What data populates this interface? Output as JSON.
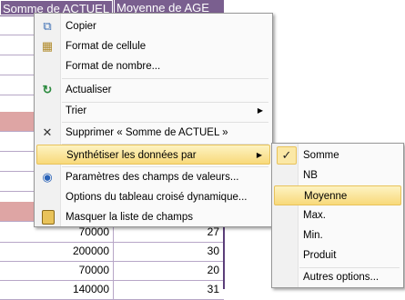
{
  "sheet": {
    "header_col1": "Somme de ACTUEL",
    "header_col2": "Moyenne de AGE",
    "rows_visible": [
      {
        "c1": "70000",
        "c2": "27"
      },
      {
        "c1": "200000",
        "c2": "30"
      },
      {
        "c1": "70000",
        "c2": "20"
      },
      {
        "c1": "140000",
        "c2": "31"
      }
    ]
  },
  "context_menu": {
    "items": [
      {
        "label": "Copier",
        "icon": "copy-icon"
      },
      {
        "label": "Format de cellule",
        "icon": "format-cell-icon"
      },
      {
        "label": "Format de nombre...",
        "icon": ""
      },
      {
        "label": "Actualiser",
        "icon": "refresh-icon"
      },
      {
        "label": "Trier",
        "icon": "",
        "arrow": "▶"
      },
      {
        "label": "Supprimer « Somme de ACTUEL »",
        "icon": "delete-icon"
      },
      {
        "label": "Synthétiser les données par",
        "icon": "",
        "arrow": "▶"
      },
      {
        "label": "Paramètres des champs de valeurs...",
        "icon": "field-settings-icon"
      },
      {
        "label": "Options du tableau croisé dynamique...",
        "icon": ""
      },
      {
        "label": "Masquer la liste de champs",
        "icon": "field-list-icon"
      }
    ]
  },
  "submenu": {
    "items": [
      {
        "label": "Somme",
        "checked": true
      },
      {
        "label": "NB"
      },
      {
        "label": "Moyenne",
        "highlighted": true
      },
      {
        "label": "Max."
      },
      {
        "label": "Min."
      },
      {
        "label": "Produit"
      },
      {
        "label": "Autres options..."
      }
    ],
    "check_glyph": "✓"
  },
  "colors": {
    "header_bg": "#7a5f8f",
    "highlight_row": "#dea5a4",
    "menu_highlight": "#f8d97a"
  }
}
